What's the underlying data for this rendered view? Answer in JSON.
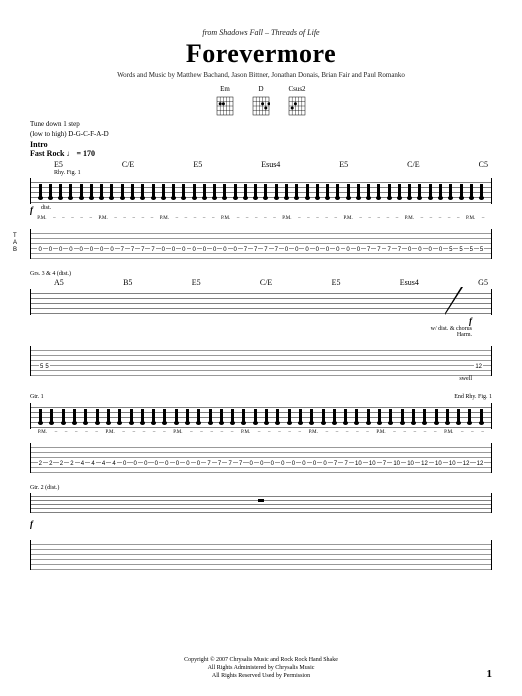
{
  "header": {
    "from_line_prefix": "from Shadows Fall –",
    "from_line_album": "Threads of Life",
    "title": "Forevermore",
    "credits": "Words and Music by Matthew Bachand, Jason Bittner, Jonathan Donais, Brian Fair and Paul Romanko"
  },
  "chord_diagrams": [
    {
      "name": "Em"
    },
    {
      "name": "D"
    },
    {
      "name": "Csus2"
    }
  ],
  "tuning": {
    "line1": "Tune down 1 step",
    "line2": "(low to high) D-G-C-F-A-D"
  },
  "section": {
    "name": "Intro",
    "tempo_label": "Fast Rock",
    "tempo_marking": "♩ = 170"
  },
  "system1": {
    "chords": [
      "E5",
      "C/E",
      "E5",
      "Esus4",
      "E5",
      "C/E",
      "C5"
    ],
    "rhyfig": "Rhy. Fig. 1",
    "dynamic": "f",
    "technique": "dist.",
    "pm": "P.M.",
    "tab_nums": [
      "0",
      "0",
      "0",
      "0",
      "0",
      "0",
      "0",
      "0",
      "7",
      "7",
      "7",
      "7",
      "0",
      "0",
      "0",
      "0",
      "0",
      "0",
      "0",
      "0",
      "7",
      "7",
      "7",
      "7",
      "0",
      "0",
      "0",
      "0",
      "0",
      "0",
      "0",
      "0",
      "7",
      "7",
      "7",
      "7",
      "0",
      "0",
      "0",
      "0",
      "5",
      "5",
      "5",
      "5"
    ]
  },
  "system2": {
    "part_label": "Grs. 3 & 4 (dist.)",
    "chords": [
      "A5",
      "B5",
      "E5",
      "C/E",
      "E5",
      "Esus4",
      "G5"
    ],
    "dynamic": "f",
    "annotation": "w/ dist. & chorus",
    "effect": "Harm.",
    "technique": "swell",
    "tab_nums": [
      "5",
      "5",
      "12"
    ]
  },
  "system3": {
    "part_label": "Gtr. 1",
    "end_label": "End Rhy. Fig. 1",
    "pm": "P.M.",
    "tab_nums": [
      "2",
      "2",
      "2",
      "2",
      "4",
      "4",
      "4",
      "4",
      "0",
      "0",
      "0",
      "0",
      "0",
      "0",
      "0",
      "0",
      "7",
      "7",
      "7",
      "7",
      "0",
      "0",
      "0",
      "0",
      "0",
      "0",
      "0",
      "0",
      "7",
      "7",
      "10",
      "10",
      "7",
      "10",
      "10",
      "12",
      "10",
      "10",
      "12",
      "12"
    ]
  },
  "system4": {
    "part_label": "Gtr. 2 (dist.)",
    "dynamic": "f"
  },
  "footer": {
    "line1": "Copyright © 2007 Chrysalis Music and Rock Rock Hand Shake",
    "line2": "All Rights Administered by Chrysalis Music",
    "line3": "All Rights Reserved   Used by Permission"
  },
  "page_number": "1"
}
